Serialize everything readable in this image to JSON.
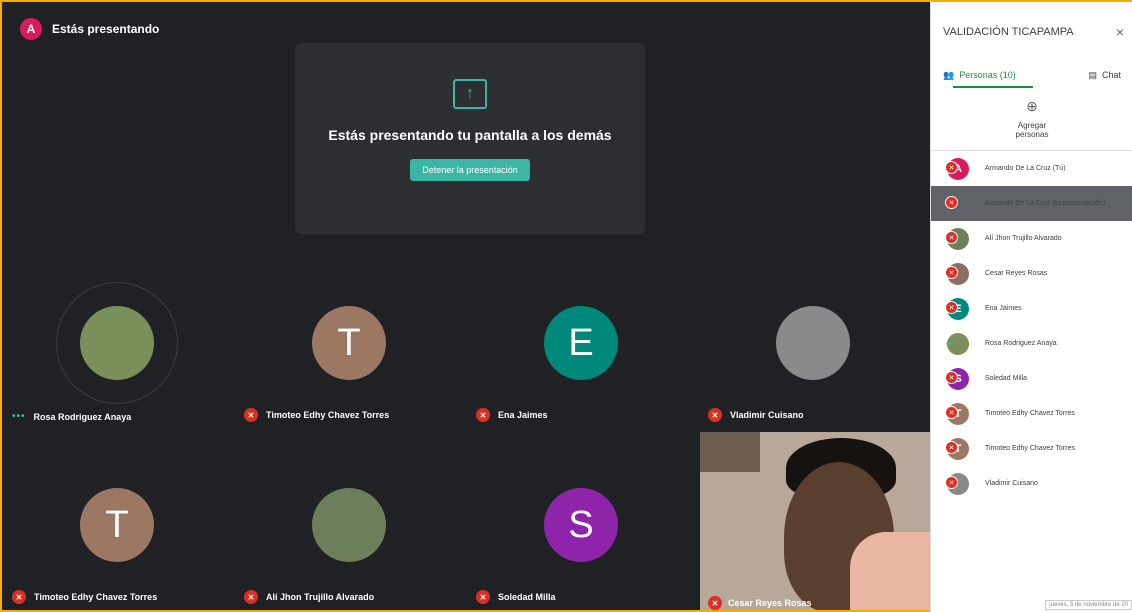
{
  "meeting": {
    "presenting_label": "Estás presentando",
    "presenter_initial": "A",
    "present_title": "Estás presentando tu pantalla a los demás",
    "stop_button": "Detener la presentación"
  },
  "tiles": [
    {
      "name": "Rosa Rodriguez Anaya",
      "initial": "",
      "color": "#7a8f5a"
    },
    {
      "name": "Timoteo Edhy Chavez Torres",
      "initial": "T",
      "color": "#9c7763"
    },
    {
      "name": "Ena Jaimes",
      "initial": "E",
      "color": "#00897b"
    },
    {
      "name": "Vladimir Cuisano",
      "initial": "",
      "color": "#8a8a8a"
    },
    {
      "name": "Timoteo Edhy Chavez Torres",
      "initial": "T",
      "color": "#9c7763"
    },
    {
      "name": "Alí Jhon Trujillo Alvarado",
      "initial": "",
      "color": "#6d7f5a"
    },
    {
      "name": "Soledad Milla",
      "initial": "S",
      "color": "#8e24aa"
    }
  ],
  "video_tile": {
    "name": "Cesar Reyes Rosas"
  },
  "panel": {
    "title": "VALIDACIÓN TICAPAMPA",
    "close": "×",
    "tab_people": "Personas (10)",
    "tab_chat": "Chat",
    "add_people": "Agregar personas",
    "participants": [
      {
        "name": "Armando De La Cruz (Tú)",
        "initial": "A",
        "color": "#d81b60",
        "status": "mic"
      },
      {
        "name": "Armando De La Cruz (tu presentación)",
        "initial": "",
        "color": "#5f6368",
        "status": "mic"
      },
      {
        "name": "Alí Jhon Trujillo Alvarado",
        "initial": "",
        "color": "#6d7f5a",
        "status": "mic"
      },
      {
        "name": "Cesar Reyes Rosas",
        "initial": "",
        "color": "#8d6e63",
        "status": "mic"
      },
      {
        "name": "Ena Jaimes",
        "initial": "E",
        "color": "#00897b",
        "status": "mic"
      },
      {
        "name": "Rosa Rodriguez Anaya",
        "initial": "",
        "color": "#7a8f5a",
        "status": "dots"
      },
      {
        "name": "Soledad Milla",
        "initial": "S",
        "color": "#8e24aa",
        "status": "mic"
      },
      {
        "name": "Timoteo Edhy Chavez Torres",
        "initial": "T",
        "color": "#9c7763",
        "status": "mic"
      },
      {
        "name": "Timoteo Edhy Chavez Torres",
        "initial": "T",
        "color": "#9c7763",
        "status": "mic"
      },
      {
        "name": "Vladimir Cuisano",
        "initial": "",
        "color": "#8a8a8a",
        "status": "mic"
      }
    ],
    "footer_date": "jueves, 5 de noviembre de 20"
  }
}
